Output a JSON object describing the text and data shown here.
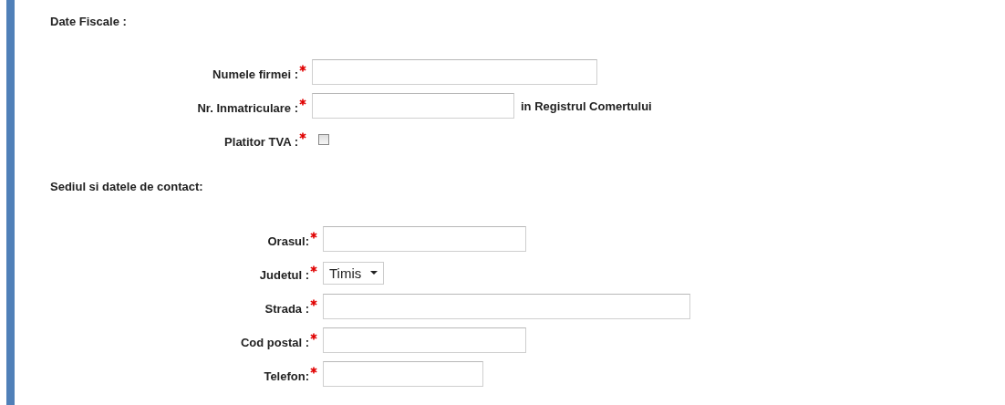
{
  "sections": [
    {
      "title": "Date Fiscale :",
      "fields": [
        {
          "label": "Numele firmei :",
          "kind": "text",
          "required": true
        },
        {
          "label": "Nr. Inmatriculare :",
          "kind": "text",
          "required": true,
          "suffix": "in Registrul Comertului"
        },
        {
          "label": "Platitor TVA :",
          "kind": "checkbox",
          "required": true,
          "checked": false
        }
      ]
    },
    {
      "title": "Sediul si datele de contact:",
      "fields": [
        {
          "label": "Orasul:",
          "kind": "text",
          "required": true
        },
        {
          "label": "Judetul :",
          "kind": "select",
          "required": true,
          "value": "Timis"
        },
        {
          "label": "Strada :",
          "kind": "text",
          "required": true
        },
        {
          "label": "Cod postal :",
          "kind": "text",
          "required": true
        },
        {
          "label": "Telefon:",
          "kind": "text",
          "required": true
        }
      ]
    }
  ]
}
